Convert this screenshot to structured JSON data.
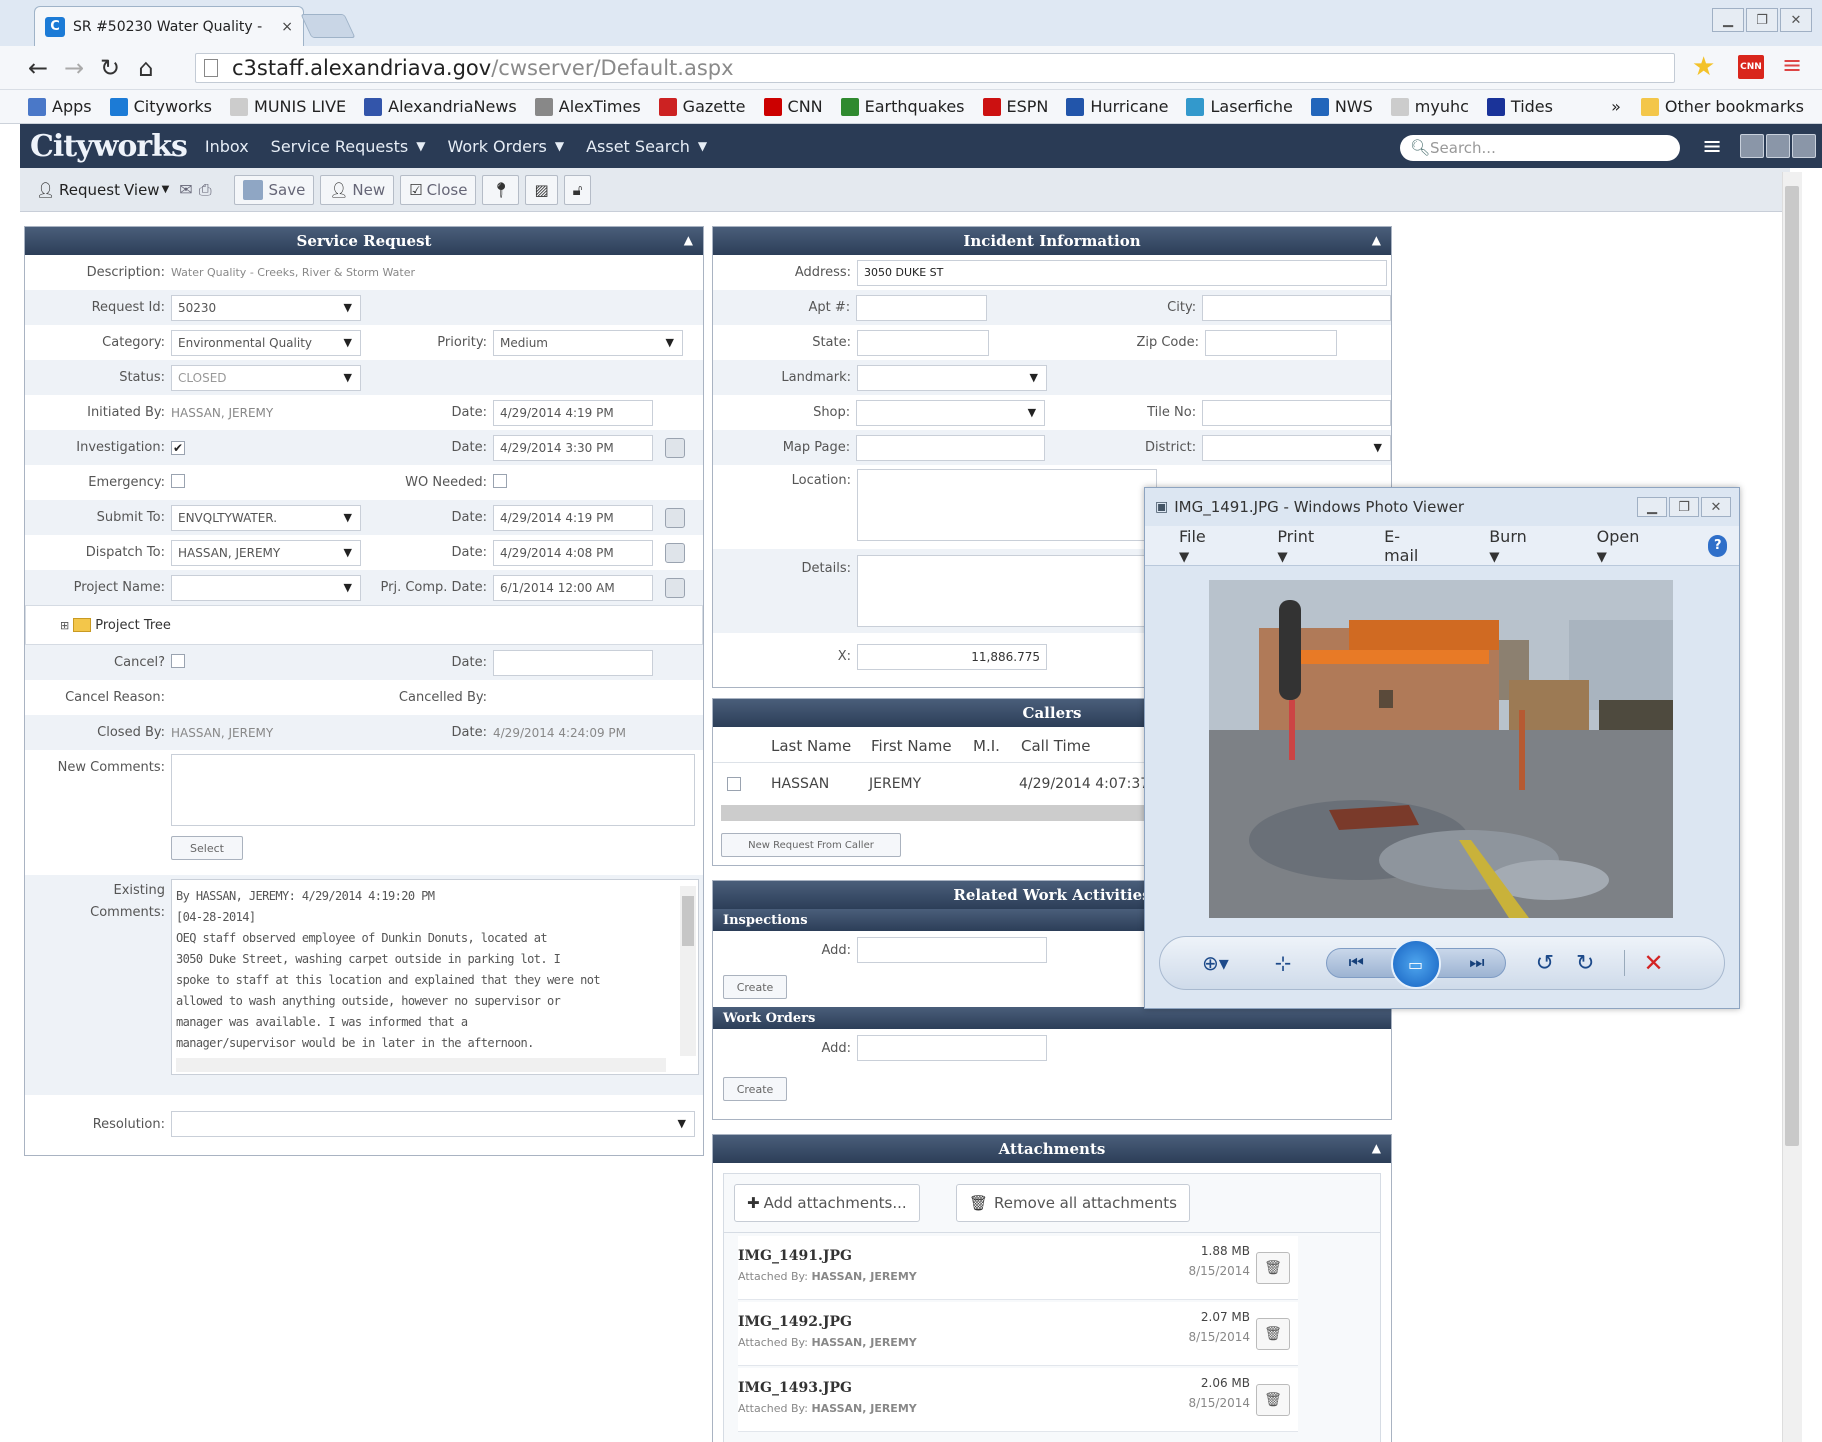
{
  "browser": {
    "tab_title": "SR #50230 Water Quality -",
    "tab_close": "×",
    "url_host": "c3staff.alexandriava.gov",
    "url_path": "/cwserver/Default.aspx",
    "bookmarks": [
      {
        "label": "Apps",
        "color": "#4a78c8"
      },
      {
        "label": "Cityworks",
        "color": "#1c7bd6"
      },
      {
        "label": "MUNIS LIVE",
        "color": "#cccccc"
      },
      {
        "label": "AlexandriaNews",
        "color": "#3355aa"
      },
      {
        "label": "AlexTimes",
        "color": "#888888"
      },
      {
        "label": "Gazette",
        "color": "#cc2222"
      },
      {
        "label": "CNN",
        "color": "#cc0000"
      },
      {
        "label": "Earthquakes",
        "color": "#2f8a2f"
      },
      {
        "label": "ESPN",
        "color": "#cc1111"
      },
      {
        "label": "Hurricane",
        "color": "#2255aa"
      },
      {
        "label": "Laserfiche",
        "color": "#3399cc"
      },
      {
        "label": "NWS",
        "color": "#2266bb"
      },
      {
        "label": "myuhc",
        "color": "#cccccc"
      },
      {
        "label": "Tides",
        "color": "#1a3399"
      }
    ],
    "other_bookmarks": "Other bookmarks"
  },
  "app": {
    "logo": "Cityworks",
    "nav": [
      {
        "label": "Inbox",
        "caret": false
      },
      {
        "label": "Service Requests",
        "caret": true
      },
      {
        "label": "Work Orders",
        "caret": true
      },
      {
        "label": "Asset Search",
        "caret": true
      }
    ],
    "search_placeholder": "Search..."
  },
  "toolbar": {
    "request_label": "Request",
    "view_label": "View",
    "save_label": "Save",
    "new_label": "New",
    "close_label": "Close"
  },
  "service_request": {
    "title": "Service Request",
    "description_label": "Description:",
    "description_value": "Water Quality - Creeks, River & Storm Water",
    "request_id_label": "Request Id:",
    "request_id_value": "50230",
    "category_label": "Category:",
    "category_value": "Environmental Quality",
    "priority_label": "Priority:",
    "priority_value": "Medium",
    "status_label": "Status:",
    "status_value": "CLOSED",
    "initiated_by_label": "Initiated By:",
    "initiated_by_value": "HASSAN, JEREMY",
    "initiated_date_label": "Date:",
    "initiated_date_value": "4/29/2014 4:19 PM",
    "investigation_label": "Investigation:",
    "investigation_date_label": "Date:",
    "investigation_date_value": "4/29/2014 3:30 PM",
    "emergency_label": "Emergency:",
    "wo_needed_label": "WO Needed:",
    "submit_to_label": "Submit To:",
    "submit_to_value": "ENVQLTYWATER.",
    "submit_date_label": "Date:",
    "submit_date_value": "4/29/2014 4:19 PM",
    "dispatch_to_label": "Dispatch To:",
    "dispatch_to_value": "HASSAN, JEREMY",
    "dispatch_date_label": "Date:",
    "dispatch_date_value": "4/29/2014 4:08 PM",
    "project_name_label": "Project Name:",
    "prj_comp_date_label": "Prj. Comp. Date:",
    "prj_comp_date_value": "6/1/2014 12:00 AM",
    "project_tree_label": "Project Tree",
    "cancel_label": "Cancel?",
    "cancel_date_label": "Date:",
    "cancel_reason_label": "Cancel Reason:",
    "cancelled_by_label": "Cancelled By:",
    "closed_by_label": "Closed By:",
    "closed_by_value": "HASSAN, JEREMY",
    "closed_date_label": "Date:",
    "closed_date_value": "4/29/2014 4:24:09 PM",
    "new_comments_label": "New Comments:",
    "select_button": "Select",
    "existing_label": "Existing",
    "comments_label": "Comments:",
    "existing_comments": [
      "By HASSAN, JEREMY: 4/29/2014 4:19:20 PM",
      "[04-28-2014]",
      "OEQ staff observed employee of Dunkin Donuts, located at",
      "3050 Duke Street, washing carpet outside in parking lot. I",
      "spoke to staff at this location and explained that they were not",
      "allowed to wash anything outside, however no supervisor or",
      "manager was available. I was informed that a",
      "manager/supervisor would be in later in the afternoon."
    ],
    "resolution_label": "Resolution:"
  },
  "incident": {
    "title": "Incident Information",
    "address_label": "Address:",
    "address_value": "3050 DUKE ST",
    "apt_label": "Apt #:",
    "city_label": "City:",
    "state_label": "State:",
    "zip_label": "Zip Code:",
    "landmark_label": "Landmark:",
    "shop_label": "Shop:",
    "tile_label": "Tile No:",
    "map_page_label": "Map Page:",
    "district_label": "District:",
    "location_label": "Location:",
    "details_label": "Details:",
    "x_label": "X:",
    "x_value": "11,886.775"
  },
  "callers": {
    "title": "Callers",
    "columns": [
      "Last Name",
      "First Name",
      "M.I.",
      "Call Time"
    ],
    "rows": [
      [
        "HASSAN",
        "JEREMY",
        "",
        "4/29/2014 4:07:37"
      ]
    ],
    "new_request_button": "New Request From Caller"
  },
  "related": {
    "title": "Related Work Activities",
    "inspections_title": "Inspections",
    "inspections_add_label": "Add:",
    "inspections_create": "Create",
    "work_orders_title": "Work Orders",
    "work_orders_add_label": "Add:",
    "work_orders_create": "Create"
  },
  "attachments": {
    "title": "Attachments",
    "add_button": "Add attachments...",
    "remove_button": "Remove all attachments",
    "items": [
      {
        "name": "IMG_1491.JPG",
        "by_label": "Attached By:",
        "by": "HASSAN, JEREMY",
        "size": "1.88 MB",
        "date": "8/15/2014"
      },
      {
        "name": "IMG_1492.JPG",
        "by_label": "Attached By:",
        "by": "HASSAN, JEREMY",
        "size": "2.07 MB",
        "date": "8/15/2014"
      },
      {
        "name": "IMG_1493.JPG",
        "by_label": "Attached By:",
        "by": "HASSAN, JEREMY",
        "size": "2.06 MB",
        "date": "8/15/2014"
      }
    ]
  },
  "photo_viewer": {
    "title": "IMG_1491.JPG - Windows Photo Viewer",
    "menu": [
      "File",
      "Print",
      "E-mail",
      "Burn",
      "Open"
    ]
  },
  "colors": {
    "header_bg": "#2a3b55",
    "panel_title_bg": "#34476a",
    "accent_blue": "#1c7bd6",
    "delete_red": "#d32323"
  }
}
